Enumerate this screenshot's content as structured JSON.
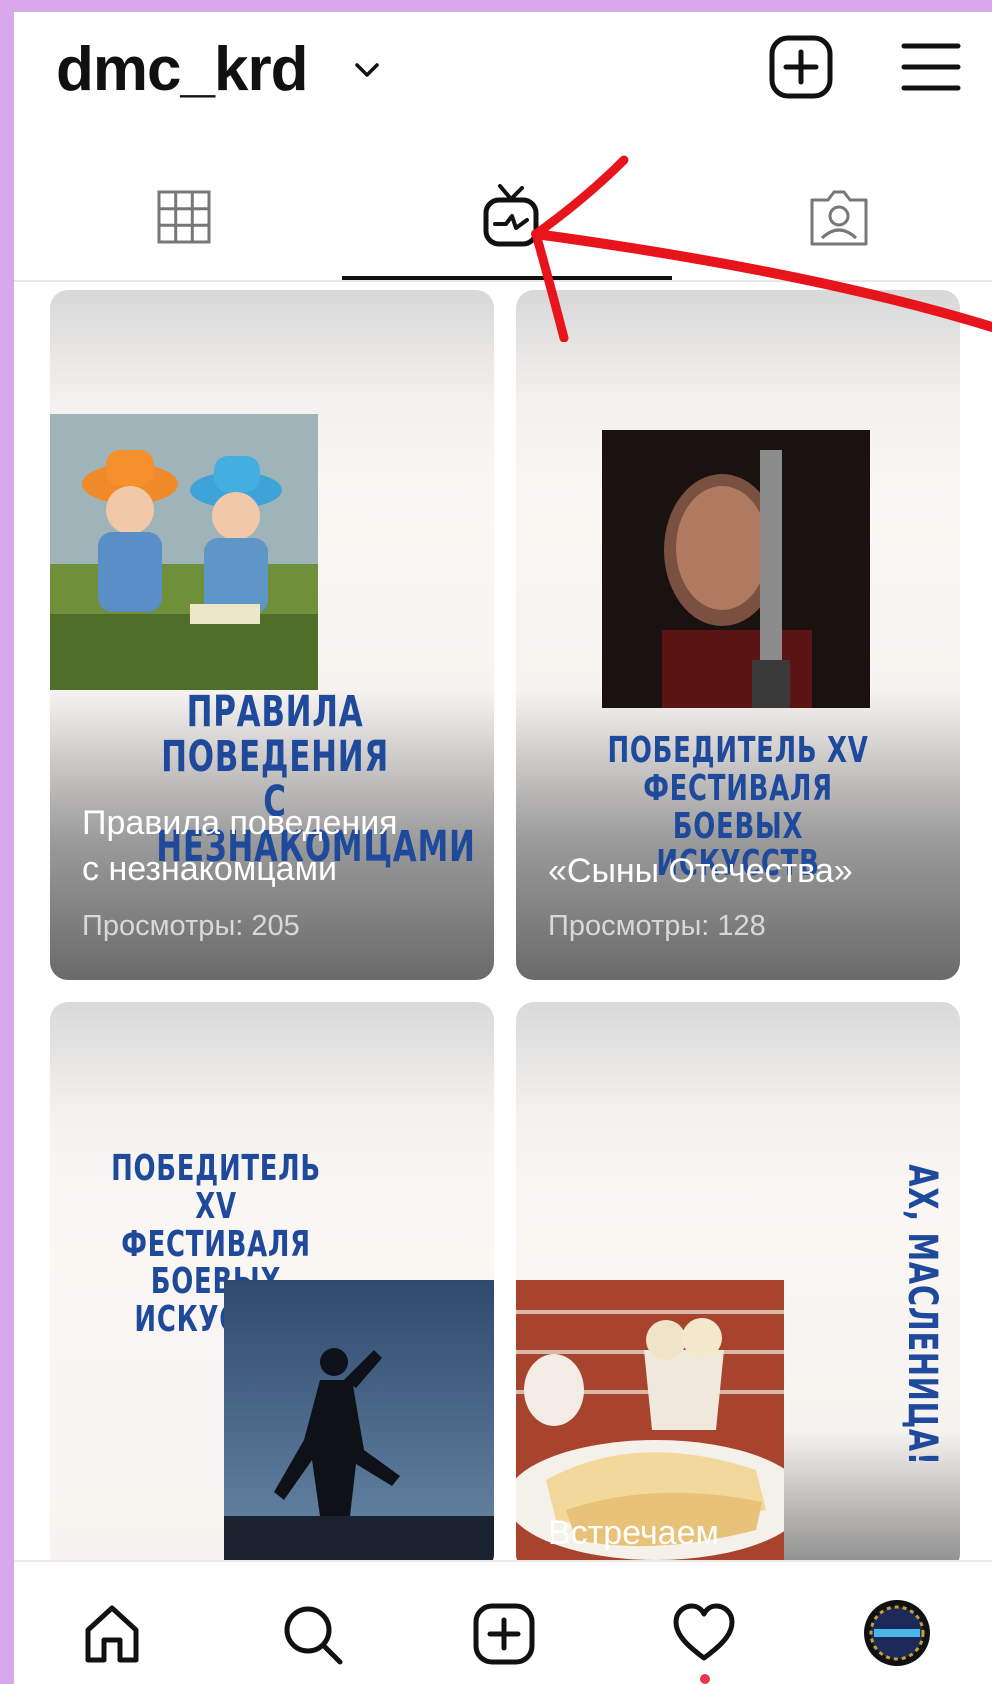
{
  "header": {
    "username": "dmc_krd"
  },
  "icons": {
    "chevron": "chevron-down-icon",
    "new_post": "plus-square-icon",
    "menu": "hamburger-menu-icon",
    "grid_tab": "grid-icon",
    "igtv_tab": "igtv-icon",
    "tagged_tab": "tagged-person-icon"
  },
  "cards": [
    {
      "poster_text": "ПРАВИЛА\nПОВЕДЕНИЯ С\nНЕЗНАКОМЦАМИ",
      "title": "Правила поведения\nс незнакомцами",
      "views": "Просмотры: 205"
    },
    {
      "poster_text": "ПОБЕДИТЕЛЬ XV\nФЕСТИВАЛЯ БОЕВЫХ\nИСКУССТВ",
      "title": "«Сыны Отечества»",
      "views": "Просмотры: 128"
    },
    {
      "poster_text": "ПОБЕДИТЕЛЬ XV\nФЕСТИВАЛЯ БОЕВЫХ\nИСКУССТВ"
    },
    {
      "poster_text": "АХ, МАСЛЕНИЦА!",
      "title": "Встречаем"
    }
  ],
  "colors": {
    "accent_poster": "#1f4a9c",
    "annotation_arrow": "#e8141b",
    "background_frame": "#d9a8ea",
    "notification_dot": "#e8374a"
  }
}
